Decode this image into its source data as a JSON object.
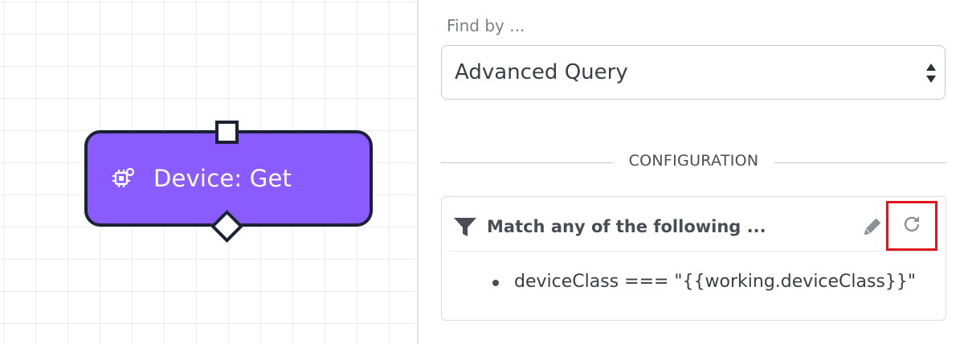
{
  "canvas": {
    "node": {
      "label": "Device: Get",
      "icon": "device-chip-icon",
      "color": "#8a5cff"
    }
  },
  "panel": {
    "find_by_label": "Find by ...",
    "find_by_value": "Advanced Query",
    "section_title": "CONFIGURATION",
    "config": {
      "filter_icon": "filter-icon",
      "title": "Match any of the following ...",
      "edit_icon": "pencil-icon",
      "refresh_icon": "refresh-icon",
      "conditions": [
        "deviceClass === \"{{working.deviceClass}}\""
      ]
    }
  }
}
